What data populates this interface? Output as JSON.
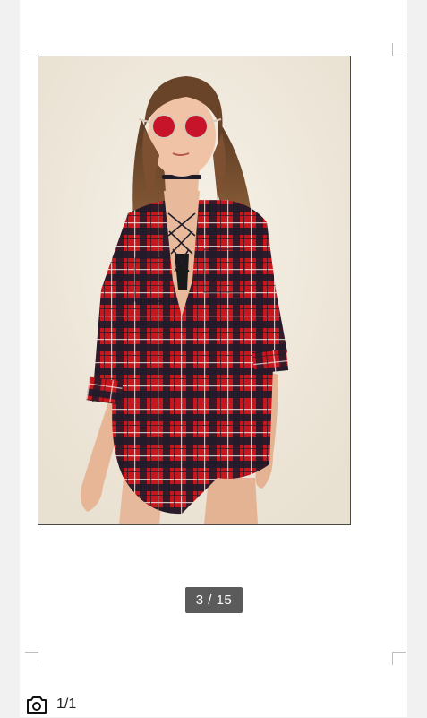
{
  "viewer": {
    "page_indicator": "3 / 15"
  },
  "bottom_bar": {
    "attachment_icon": "camera-icon",
    "image_count": "1/1"
  },
  "colors": {
    "plaid_red": "#c8161d",
    "plaid_dark": "#1e1b2a",
    "background": "#efe9dd"
  }
}
